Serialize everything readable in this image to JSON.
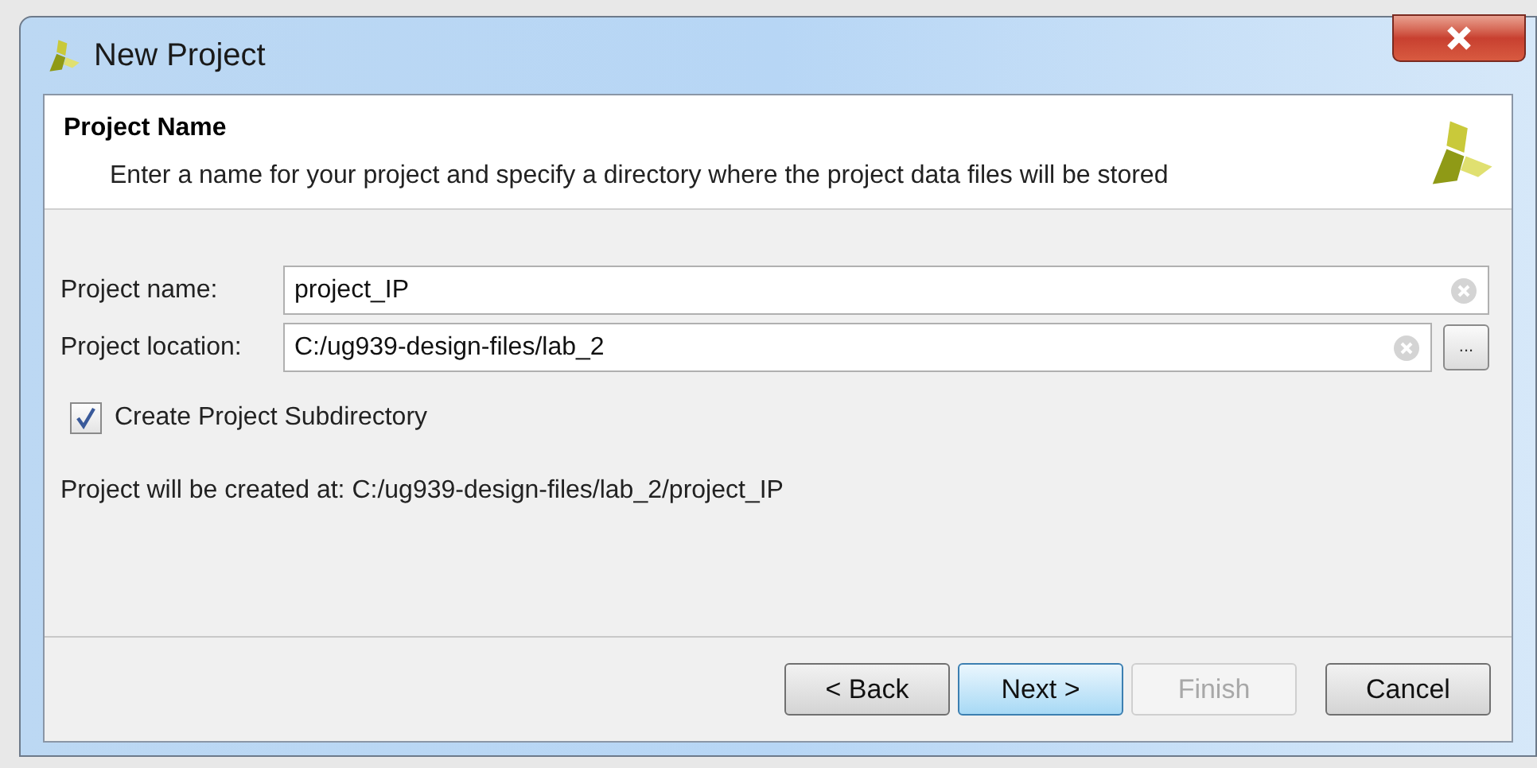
{
  "window": {
    "title": "New Project"
  },
  "header": {
    "title": "Project Name",
    "description": "Enter a name for your project and specify a directory where the project data files will be stored"
  },
  "fields": [
    {
      "label": "Project name:",
      "value": "project_IP",
      "browse": false
    },
    {
      "label": "Project location:",
      "value": "C:/ug939-design-files/lab_2",
      "browse": true,
      "browse_label": "..."
    }
  ],
  "checkbox": {
    "label": "Create Project Subdirectory",
    "checked": true
  },
  "summary": "Project will be created at: C:/ug939-design-files/lab_2/project_IP",
  "buttons": [
    {
      "label": "< Back",
      "disabled": false,
      "focused": false
    },
    {
      "label": "Next >",
      "disabled": false,
      "focused": true
    },
    {
      "label": "Finish",
      "disabled": true,
      "focused": false
    },
    {
      "label": "Cancel",
      "disabled": false,
      "focused": false
    }
  ]
}
